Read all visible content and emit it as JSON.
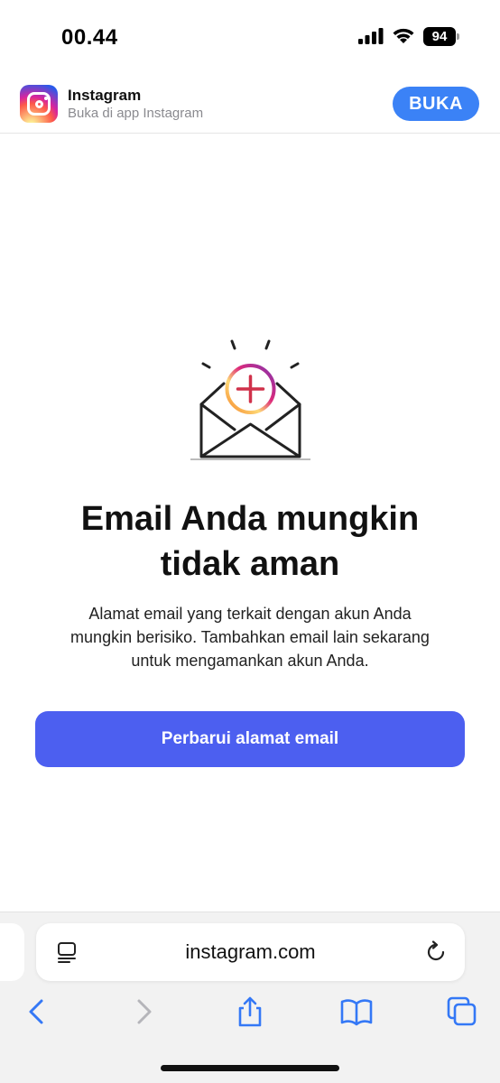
{
  "status_bar": {
    "time": "00.44",
    "battery_level": "94",
    "signal_icon": "cellular-signal-icon",
    "wifi_icon": "wifi-icon"
  },
  "app_banner": {
    "app_name": "Instagram",
    "subtitle": "Buka di app Instagram",
    "open_label": "BUKA",
    "icon": "instagram-logo-icon",
    "accent_color": "#3b82f6"
  },
  "main": {
    "illustration_icon": "email-envelope-plus-icon",
    "title": "Email Anda mungkin tidak aman",
    "description": "Alamat email yang terkait dengan akun Anda mungkin berisiko. Tambahkan email lain sekarang untuk mengamankan akun Anda.",
    "button_label": "Perbarui alamat email",
    "button_color": "#4c5ff0"
  },
  "browser": {
    "url": "instagram.com",
    "reader_icon": "reader-mode-icon",
    "reload_icon": "reload-icon",
    "toolbar": [
      "back-icon",
      "forward-icon",
      "share-icon",
      "bookmarks-icon",
      "tabs-icon"
    ],
    "toolbar_color": "#3478f6"
  }
}
